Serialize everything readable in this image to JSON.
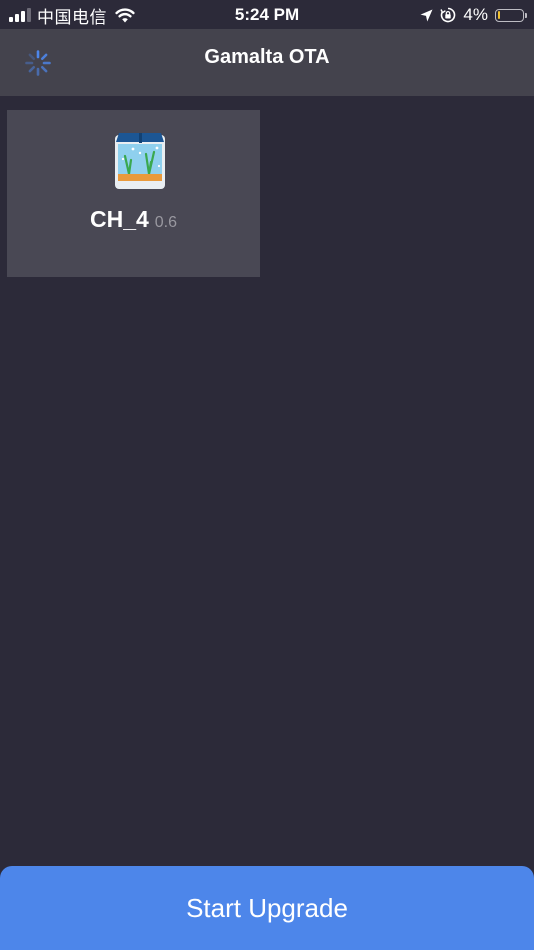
{
  "status_bar": {
    "carrier": "中国电信",
    "time": "5:24 PM",
    "battery_percent": "4%",
    "battery_level": 0.04,
    "signal_icon": "cellular-signal-icon",
    "wifi_icon": "wifi-icon",
    "location_icon": "location-arrow-icon",
    "lock_icon": "orientation-lock-icon",
    "battery_icon": "battery-icon",
    "battery_color": "#f2c230"
  },
  "nav": {
    "title": "Gamalta OTA",
    "spinner_icon": "loading-spinner-icon",
    "spinner_color": "#4d86ea"
  },
  "devices": [
    {
      "name": "CH_4",
      "version": "0.6",
      "icon": "aquarium-icon"
    }
  ],
  "actions": {
    "start_label": "Start Upgrade",
    "accent_color": "#4d86ea"
  },
  "colors": {
    "background": "#2c2a39",
    "nav_background": "#44434d",
    "card_background": "#494854"
  }
}
